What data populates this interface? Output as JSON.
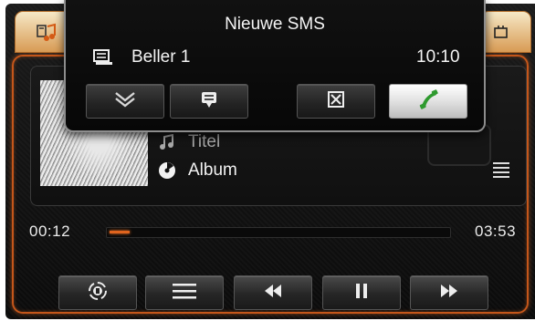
{
  "popup": {
    "title": "Nieuwe SMS",
    "sender": "Beller 1",
    "time": "10:10",
    "buttons": [
      {
        "name": "expand-button",
        "icon": "double-chevron-down-icon"
      },
      {
        "name": "read-message-button",
        "icon": "message-icon"
      },
      {
        "name": "dismiss-button",
        "icon": "close-box-icon"
      },
      {
        "name": "call-back-button",
        "icon": "phone-call-icon"
      }
    ]
  },
  "media": {
    "title": "Titel",
    "album": "Album"
  },
  "playback": {
    "current_time": "00:12",
    "total_time": "03:53",
    "progress": 0.06
  },
  "controls": [
    {
      "name": "source-button",
      "icon": "speaker-icon"
    },
    {
      "name": "playlist-button",
      "icon": "list-icon"
    },
    {
      "name": "previous-button",
      "icon": "rewind-icon"
    },
    {
      "name": "pause-button",
      "icon": "pause-icon"
    },
    {
      "name": "next-button",
      "icon": "fast-forward-icon"
    }
  ],
  "colors": {
    "accent": "#e0641e",
    "frame": "#c4561a",
    "call_icon": "#2f9a2f"
  }
}
